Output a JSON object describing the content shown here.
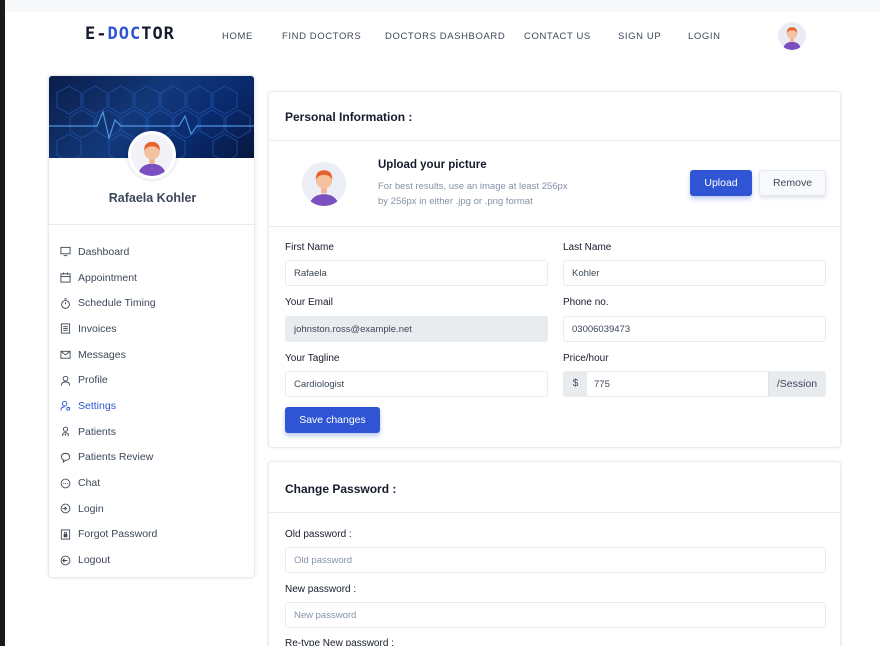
{
  "brand": {
    "logo_prefix": "E-",
    "logo_accent": "DOC",
    "logo_suffix": "TOR",
    "accent_color": "#2f55d4"
  },
  "nav": {
    "items": [
      "HOME",
      "FIND DOCTORS",
      "DOCTORS DASHBOARD",
      "CONTACT US",
      "SIGN UP",
      "LOGIN"
    ]
  },
  "sidebar": {
    "name": "Rafaela Kohler",
    "items": [
      {
        "label": "Dashboard",
        "icon": "monitor-icon"
      },
      {
        "label": "Appointment",
        "icon": "calendar-icon"
      },
      {
        "label": "Schedule Timing",
        "icon": "timer-icon"
      },
      {
        "label": "Invoices",
        "icon": "invoice-icon"
      },
      {
        "label": "Messages",
        "icon": "mail-icon"
      },
      {
        "label": "Profile",
        "icon": "user-icon"
      },
      {
        "label": "Settings",
        "icon": "user-settings-icon",
        "active": true
      },
      {
        "label": "Patients",
        "icon": "stethoscope-icon"
      },
      {
        "label": "Patients Review",
        "icon": "chat-bubble-icon"
      },
      {
        "label": "Chat",
        "icon": "chat-circle-icon"
      },
      {
        "label": "Login",
        "icon": "login-icon"
      },
      {
        "label": "Forgot Password",
        "icon": "lock-file-icon"
      },
      {
        "label": "Logout",
        "icon": "logout-icon"
      }
    ]
  },
  "personal": {
    "title": "Personal Information :",
    "upload_title": "Upload your picture",
    "upload_hint_1": "For best results, use an image at least 256px",
    "upload_hint_2": "by 256px in either .jpg or .png format",
    "upload_button": "Upload",
    "remove_button": "Remove",
    "first_name_label": "First Name",
    "first_name_value": "Rafaela",
    "last_name_label": "Last Name",
    "last_name_value": "Kohler",
    "email_label": "Your Email",
    "email_value": "johnston.ross@example.net",
    "phone_label": "Phone no.",
    "phone_value": "03006039473",
    "tagline_label": "Your Tagline",
    "tagline_value": "Cardiologist",
    "price_label": "Price/hour",
    "price_prefix": "$",
    "price_value": "775",
    "price_suffix": "/Session",
    "save_button": "Save changes"
  },
  "password": {
    "title": "Change Password :",
    "old_label": "Old password :",
    "old_placeholder": "Old password",
    "new_label": "New password :",
    "new_placeholder": "New password",
    "retype_label": "Re-type New password :"
  }
}
